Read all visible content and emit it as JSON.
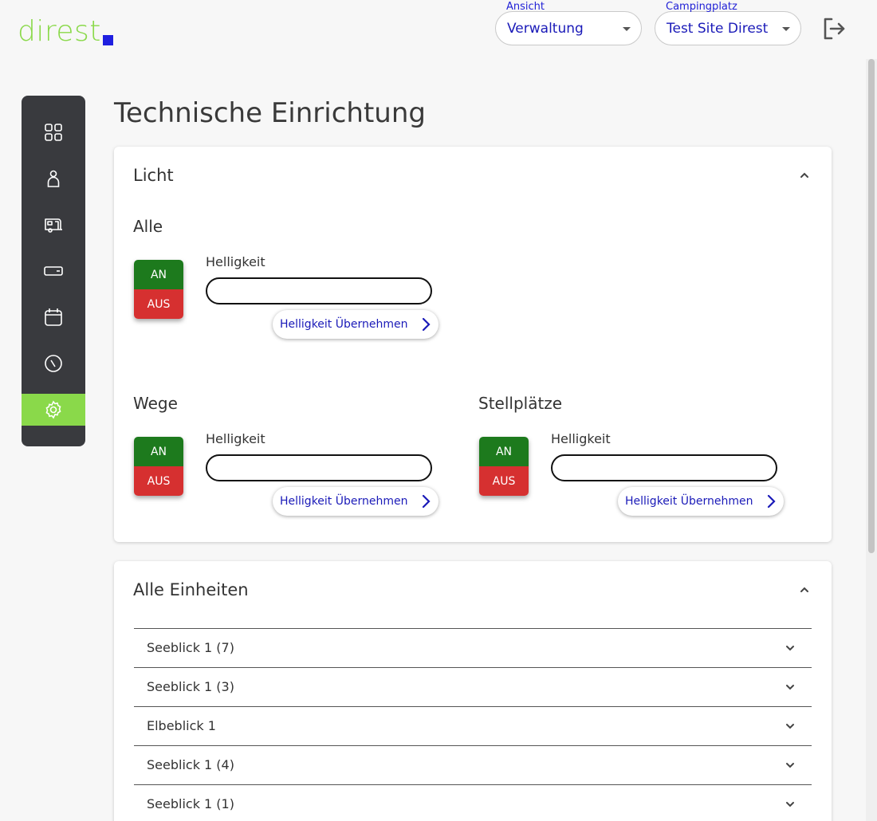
{
  "brand": {
    "logo_text": "direst",
    "logo_square_color": "#1f1fe0",
    "logo_color": "#8ad94a"
  },
  "header": {
    "view_select": {
      "label": "Ansicht",
      "value": "Verwaltung"
    },
    "site_select": {
      "label": "Campingplatz",
      "value": "Test Site Direst"
    },
    "logout_icon": "logout-icon"
  },
  "sidebar": {
    "items": [
      {
        "icon": "dashboard-grid-icon",
        "active": false
      },
      {
        "icon": "person-icon",
        "active": false
      },
      {
        "icon": "caravan-icon",
        "active": false
      },
      {
        "icon": "wallet-icon",
        "active": false
      },
      {
        "icon": "calendar-icon",
        "active": false
      },
      {
        "icon": "compass-icon",
        "active": false
      },
      {
        "icon": "gear-icon",
        "active": true
      }
    ],
    "active_color": "#8ad94a"
  },
  "page": {
    "title": "Technische Einrichtung"
  },
  "licht": {
    "title": "Licht",
    "sections": [
      {
        "title": "Alle",
        "on_label": "AN",
        "off_label": "AUS",
        "field_label": "Helligkeit",
        "field_value": "",
        "apply_label": "Helligkeit Übernehmen"
      },
      {
        "title": "Wege",
        "on_label": "AN",
        "off_label": "AUS",
        "field_label": "Helligkeit",
        "field_value": "",
        "apply_label": "Helligkeit Übernehmen"
      },
      {
        "title": "Stellplätze",
        "on_label": "AN",
        "off_label": "AUS",
        "field_label": "Helligkeit",
        "field_value": "",
        "apply_label": "Helligkeit Übernehmen"
      }
    ]
  },
  "units": {
    "title": "Alle Einheiten",
    "items": [
      {
        "label": "Seeblick 1 (7)"
      },
      {
        "label": "Seeblick 1 (3)"
      },
      {
        "label": "Elbeblick 1"
      },
      {
        "label": "Seeblick 1 (4)"
      },
      {
        "label": "Seeblick 1 (1)"
      }
    ]
  },
  "colors": {
    "on": "#1d7a1d",
    "off": "#d63030",
    "accent_text": "#1a1ab8"
  }
}
